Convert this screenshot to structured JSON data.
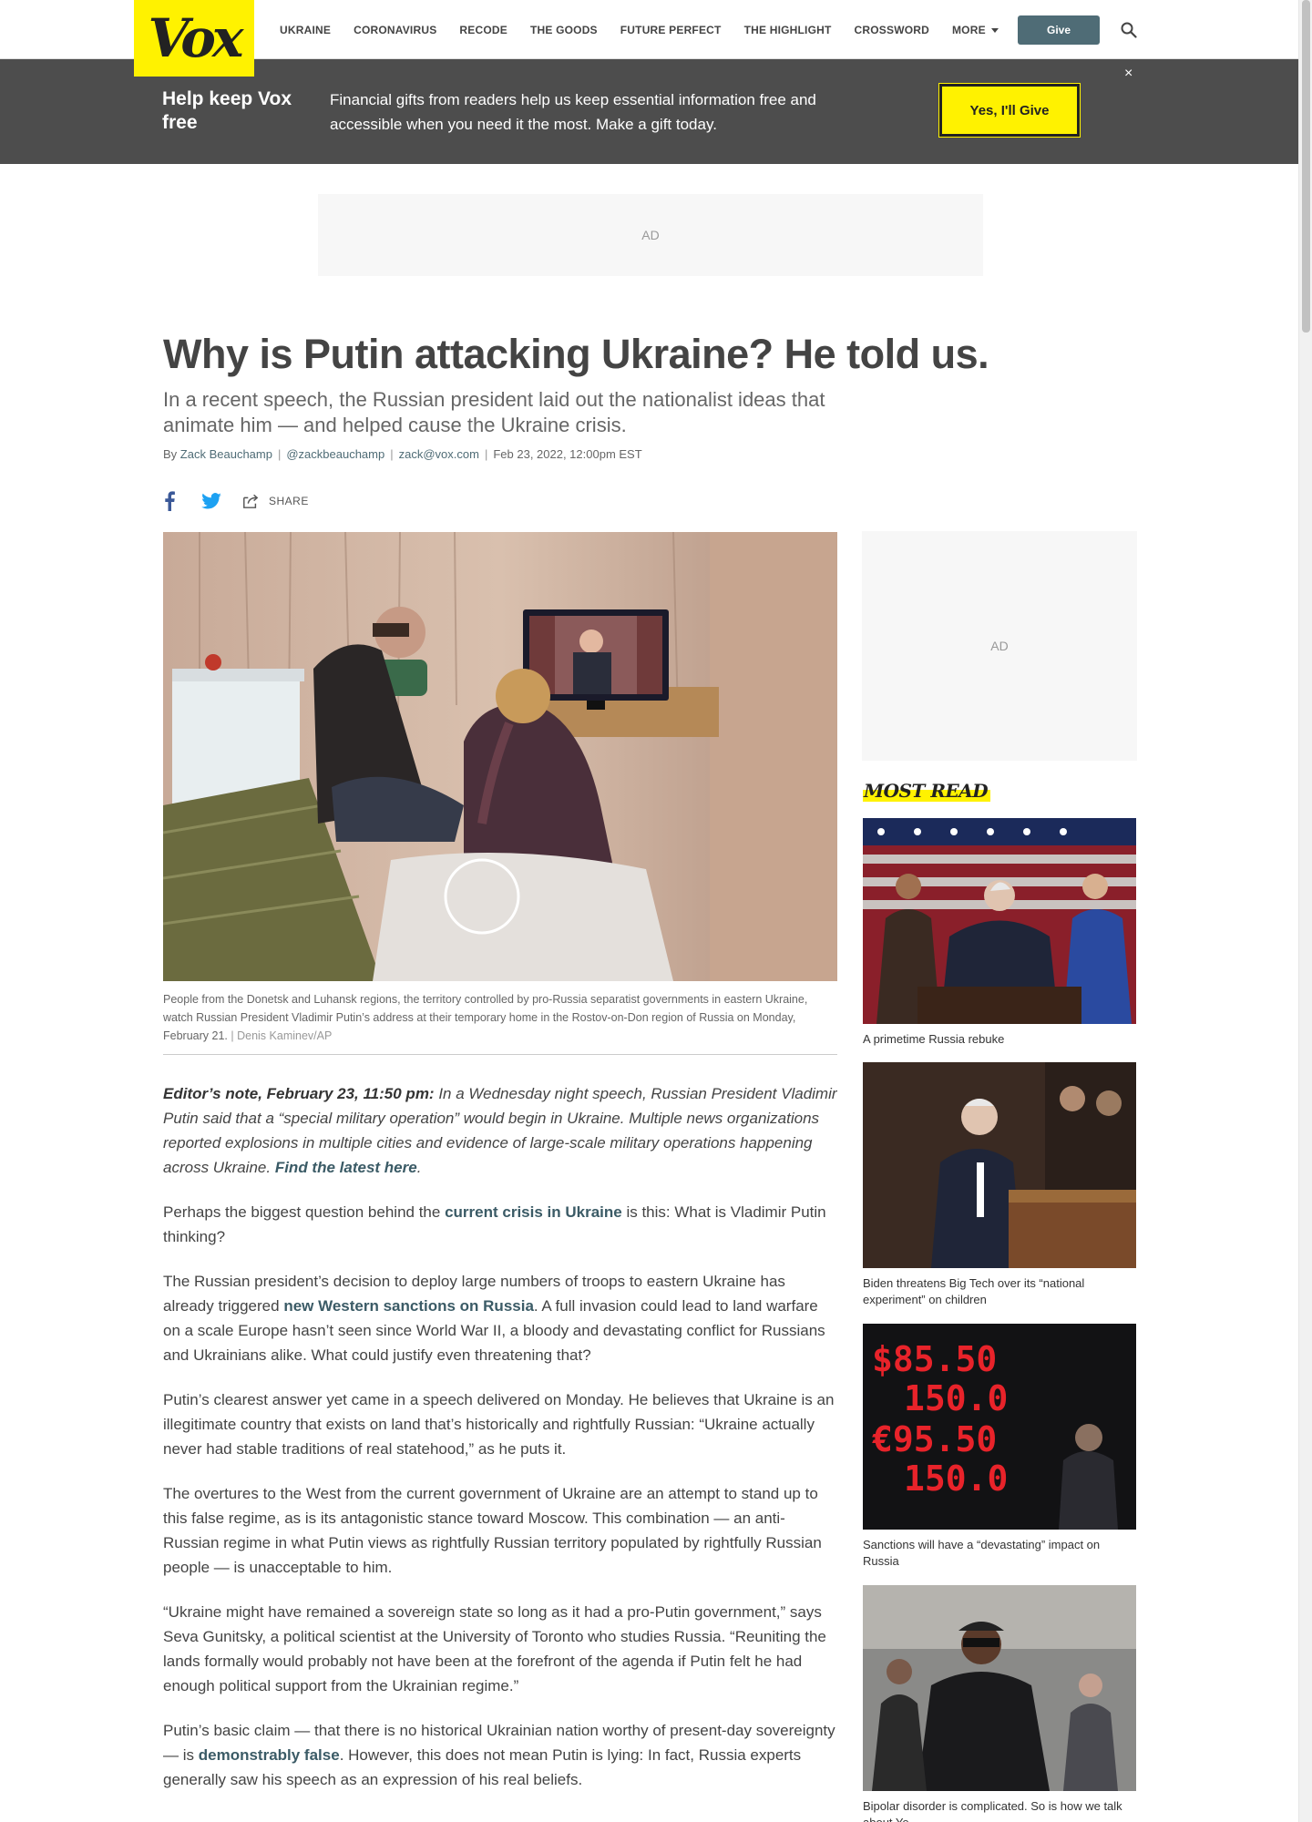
{
  "brand": {
    "logo_text": "Vox"
  },
  "nav": {
    "items": [
      "Ukraine",
      "Coronavirus",
      "Recode",
      "The Goods",
      "Future Perfect",
      "The Highlight",
      "Crossword"
    ],
    "more_label": "More",
    "give_label": "Give"
  },
  "banner": {
    "title": "Help keep Vox free",
    "text": "Financial gifts from readers help us keep essential information free and accessible when you need it the most. Make a gift today.",
    "button_label": "Yes, I'll Give",
    "close_glyph": "×"
  },
  "ads": {
    "top_label": "AD",
    "side_label": "AD"
  },
  "article": {
    "headline": "Why is Putin attacking Ukraine? He told us.",
    "dek": "In a recent speech, the Russian president laid out the nationalist ideas that animate him — and helped cause the Ukraine crisis.",
    "byline": {
      "by": "By",
      "author": "Zack Beauchamp",
      "twitter": "@zackbeauchamp",
      "email": "zack@vox.com",
      "date": "Feb 23, 2022, 12:00pm EST"
    },
    "share_label": "SHARE",
    "caption": "People from the Donetsk and Luhansk regions, the territory controlled by pro-Russia separatist governments in eastern Ukraine, watch Russian President Vladimir Putin’s address at their temporary home in the Rostov-on-Don region of Russia on Monday, February 21.",
    "credit": "Denis Kaminev/AP",
    "editor_note": {
      "label": "Editor’s note, February 23, 11:50 pm:",
      "text": " In a Wednesday night speech, Russian President Vladimir Putin said that a “special military operation” would begin in Ukraine. Multiple news organizations reported explosions in multiple cities and evidence of large-scale military operations happening across Ukraine. ",
      "link": "Find the latest here",
      "end": "."
    },
    "p1": {
      "a": "Perhaps the biggest question behind the ",
      "link": "current crisis in Ukraine",
      "b": " is this: What is Vladimir Putin thinking?"
    },
    "p2": {
      "a": "The Russian president’s decision to deploy large numbers of troops to eastern Ukraine has already triggered ",
      "link": "new Western sanctions on Russia",
      "b": ". A full invasion could lead to land warfare on a scale Europe hasn’t seen since World War II, a bloody and devastating conflict for Russians and Ukrainians alike. What could justify even threatening that?"
    },
    "p3": "Putin’s clearest answer yet came in a speech delivered on Monday. He believes that Ukraine is an illegitimate country that exists on land that’s historically and rightfully Russian: “Ukraine actually never had stable traditions of real statehood,” as he puts it.",
    "p4": "The overtures to the West from the current government of Ukraine are an attempt to stand up to this false regime, as is its antagonistic stance toward Moscow. This combination — an anti-Russian regime in what Putin views as rightfully Russian territory populated by rightfully Russian people — is unacceptable to him.",
    "p5": "“Ukraine might have remained a sovereign state so long as it had a pro-Putin government,” says Seva Gunitsky, a political scientist at the University of Toronto who studies Russia. “Reuniting the lands formally would probably not have been at the forefront of the agenda if Putin felt he had enough political support from the Ukrainian regime.”",
    "p6": {
      "a": "Putin’s basic claim — that there is no historical Ukrainian nation worthy of present-day sovereignty — is ",
      "link": "demonstrably false",
      "b": ". However, this does not mean Putin is lying: In fact, Russia experts generally saw his speech as an expression of his real beliefs."
    }
  },
  "most_read": {
    "title": "MOST READ",
    "items": [
      {
        "title": "A primetime Russia rebuke"
      },
      {
        "title": "Biden threatens Big Tech over its “national experiment” on children"
      },
      {
        "title": "Sanctions will have a “devastating” impact on Russia",
        "sign_lines": [
          "$85.50",
          "150.0",
          "€95.50",
          "150.0"
        ]
      },
      {
        "title": "Bipolar disorder is complicated. So is how we talk about Ye"
      }
    ]
  },
  "colors": {
    "accent_yellow": "#fff200",
    "link_teal": "#3b5b66",
    "banner_gray": "#4d4d4d"
  }
}
